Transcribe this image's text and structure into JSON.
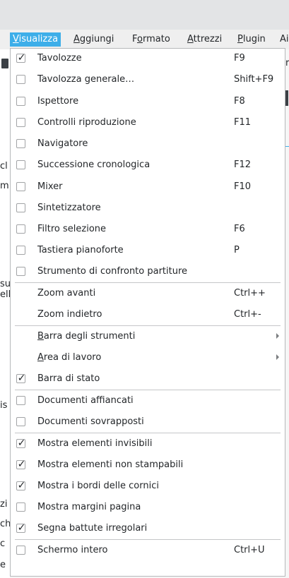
{
  "menubar": {
    "items": [
      {
        "pre": "",
        "u": "V",
        "post": "isualizza"
      },
      {
        "pre": "",
        "u": "A",
        "post": "ggiungi"
      },
      {
        "pre": "F",
        "u": "o",
        "post": "rmato"
      },
      {
        "pre": "",
        "u": "A",
        "post": "ttrezzi"
      },
      {
        "pre": "",
        "u": "P",
        "post": "lugin"
      },
      {
        "pre": "",
        "u": "",
        "post": "Ai"
      }
    ]
  },
  "background": {
    "left_fragments": [
      "cl",
      "m",
      "su",
      "ell",
      "is",
      "zi",
      "ch",
      "c",
      "e"
    ],
    "right_fragments": [
      "r"
    ]
  },
  "menu": {
    "items": [
      {
        "label": "Tavolozze",
        "shortcut": "F9",
        "checkbox": true,
        "checked": true
      },
      {
        "label": "Tavolozza generale…",
        "shortcut": "Shift+F9",
        "checkbox": true,
        "checked": false
      },
      {
        "label": "Ispettore",
        "shortcut": "F8",
        "checkbox": true,
        "checked": false
      },
      {
        "label": "Controlli riproduzione",
        "shortcut": "F11",
        "checkbox": true,
        "checked": false
      },
      {
        "label": "Navigatore",
        "shortcut": "",
        "checkbox": true,
        "checked": false
      },
      {
        "label": "Successione cronologica",
        "shortcut": "F12",
        "checkbox": true,
        "checked": false
      },
      {
        "label": "Mixer",
        "shortcut": "F10",
        "checkbox": true,
        "checked": false
      },
      {
        "label": "Sintetizzatore",
        "shortcut": "",
        "checkbox": true,
        "checked": false
      },
      {
        "label": "Filtro selezione",
        "shortcut": "F6",
        "checkbox": true,
        "checked": false
      },
      {
        "label": "Tastiera pianoforte",
        "shortcut": "P",
        "checkbox": true,
        "checked": false
      },
      {
        "label": "Strumento di confronto partiture",
        "shortcut": "",
        "checkbox": true,
        "checked": false
      },
      {
        "label": "Zoom avanti",
        "shortcut": "Ctrl++",
        "checkbox": false,
        "checked": false
      },
      {
        "label": "Zoom indietro",
        "shortcut": "Ctrl+-",
        "checkbox": false,
        "checked": false
      },
      {
        "label_u": "B",
        "label_rest": "arra degli strumenti",
        "shortcut": "",
        "checkbox": false,
        "checked": false,
        "submenu": true
      },
      {
        "label_u": "A",
        "label_rest": "rea di lavoro",
        "shortcut": "",
        "checkbox": false,
        "checked": false,
        "submenu": true
      },
      {
        "label": "Barra di stato",
        "shortcut": "",
        "checkbox": true,
        "checked": true
      },
      {
        "label": "Documenti affiancati",
        "shortcut": "",
        "checkbox": true,
        "checked": false
      },
      {
        "label": "Documenti sovrapposti",
        "shortcut": "",
        "checkbox": true,
        "checked": false
      },
      {
        "label": "Mostra elementi invisibili",
        "shortcut": "",
        "checkbox": true,
        "checked": true
      },
      {
        "label": "Mostra elementi non stampabili",
        "shortcut": "",
        "checkbox": true,
        "checked": true
      },
      {
        "label": "Mostra i bordi delle cornici",
        "shortcut": "",
        "checkbox": true,
        "checked": true
      },
      {
        "label": "Mostra margini pagina",
        "shortcut": "",
        "checkbox": true,
        "checked": false
      },
      {
        "label": "Segna battute irregolari",
        "shortcut": "",
        "checkbox": true,
        "checked": true
      },
      {
        "label": "Schermo intero",
        "shortcut": "Ctrl+U",
        "checkbox": true,
        "checked": false
      }
    ],
    "check_glyph": "✓"
  }
}
